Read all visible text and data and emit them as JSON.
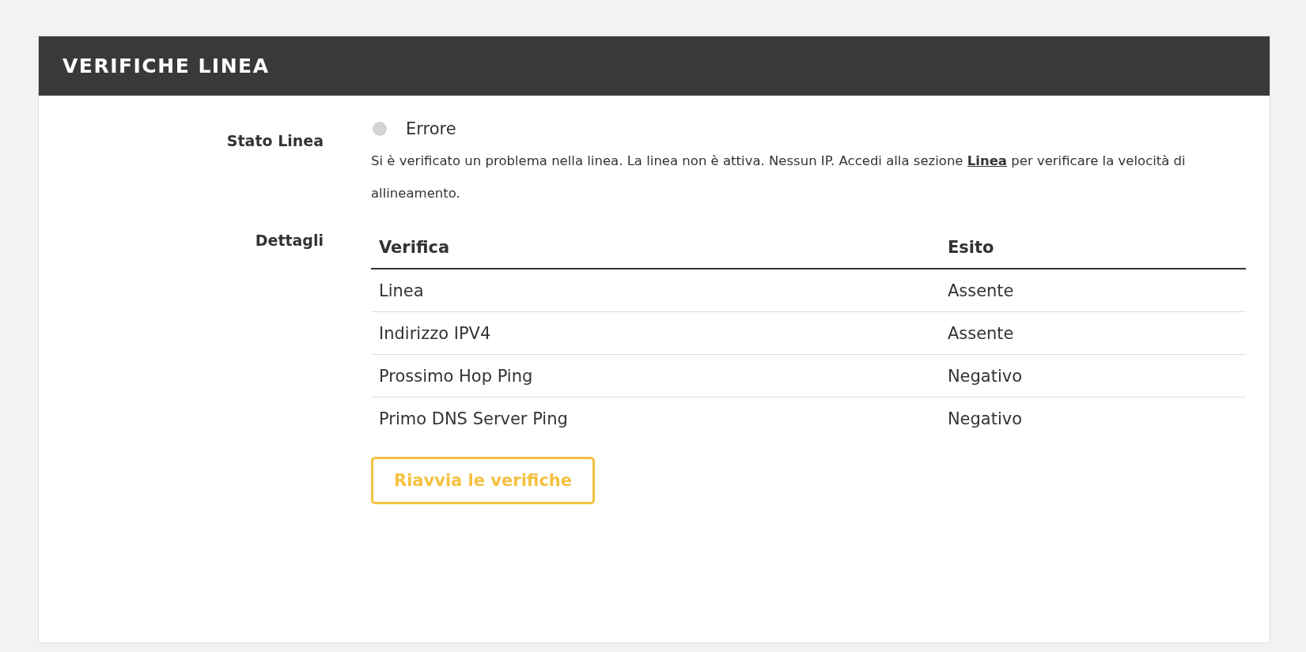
{
  "panel": {
    "title": "VERIFICHE LINEA"
  },
  "status": {
    "label": "Stato Linea",
    "value": "Errore",
    "color": "#d3d3d3",
    "description": {
      "before": "Si è verificato un problema nella linea. La linea non è attiva. Nessun IP. Accedi alla sezione ",
      "link": "Linea",
      "after": " per verificare la velocità di allineamento."
    }
  },
  "details": {
    "label": "Dettagli",
    "table": {
      "columns": [
        "Verifica",
        "Esito"
      ],
      "rows": [
        [
          "Linea",
          "Assente"
        ],
        [
          "Indirizzo IPV4",
          "Assente"
        ],
        [
          "Prossimo Hop Ping",
          "Negativo"
        ],
        [
          "Primo DNS Server Ping",
          "Negativo"
        ]
      ]
    },
    "button": "Riavvia le verifiche"
  }
}
